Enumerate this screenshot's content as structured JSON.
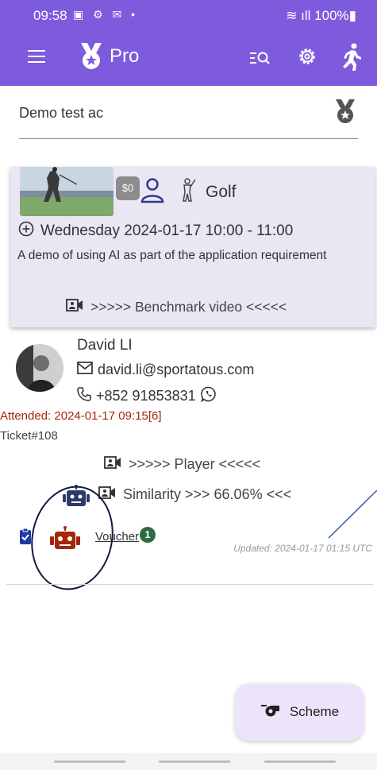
{
  "status": {
    "time": "09:58",
    "icons": "▣ ⚙ ✉ •",
    "battery": "100%"
  },
  "appbar": {
    "title": "Pro",
    "icons": [
      "menu-icon",
      "medal-logo-icon",
      "filter-search-icon",
      "gear-icon",
      "running-icon"
    ]
  },
  "search": {
    "value": "Demo test ac"
  },
  "session": {
    "price": "$0",
    "sport": "Golf",
    "datetime": "Wednesday 2024-01-17 10:00 - 11:00",
    "description": "A demo of using AI as part of the application requirement",
    "benchmark_link": ">>>>> Benchmark video <<<<<"
  },
  "player": {
    "name": "David LI",
    "email": "david.li@sportatous.com",
    "phone": "+852 91853831",
    "attended": "Attended: 2024-01-17 09:15[6]",
    "ticket": "Ticket#108",
    "player_link": ">>>>> Player <<<<<",
    "similarity": "Similarity >>> 66.06% <<<",
    "voucher_label": "Voucher",
    "voucher_count": "1",
    "updated": "Updated: 2024-01-17 01:15 UTC"
  },
  "fab": {
    "label": "Scheme"
  },
  "colors": {
    "primary": "#7e5bdc",
    "card_bg": "#eae6f3",
    "attended": "#a3270a",
    "robot_red": "#a3270a",
    "robot_blue": "#2d3a6e",
    "badge": "#2e6b40",
    "fab_bg": "#ede3fb"
  }
}
